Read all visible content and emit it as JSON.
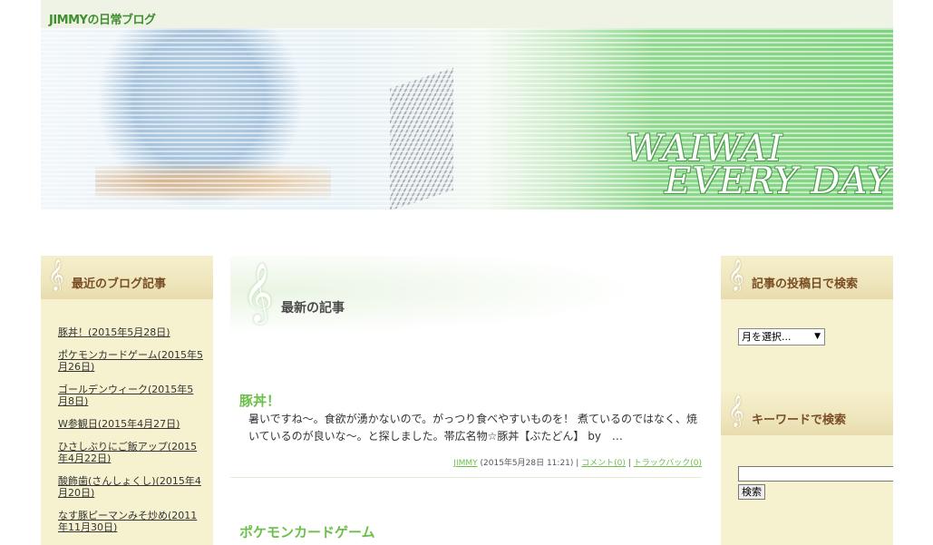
{
  "header": {
    "site_title": "JIMMYの日常ブログ",
    "banner_line1": "WAIWAI",
    "banner_line2": "EVERY DAY"
  },
  "left_sidebar": {
    "widget_title": "最近のブログ記事",
    "recent_posts": [
      "豚丼！(2015年5月28日)",
      "ポケモンカードゲーム(2015年5月26日)",
      "ゴールデンウィーク(2015年5月8日)",
      "W参観日(2015年4月27日)",
      "ひさしぶりにご飯アップ(2015年4月22日)",
      "酸飾歯(さんしょくし)(2015年4月20日)",
      "なす豚ピーマンみそ炒め(2011年11月30日)"
    ]
  },
  "main": {
    "section_title": "最新の記事",
    "post1": {
      "title": "豚丼！",
      "excerpt": "暑いですね～。食欲が湧かないので。がっつり食べやすいものを！ 煮ているのではなく、焼いているのが良いな～。と探しました。帯広名物☆豚丼【ぶたどん】 by　…",
      "author": "JIMMY",
      "date": " (2015年5月28日 11:21) | ",
      "comments": "コメント(0)",
      "separator": " | ",
      "trackbacks": "トラックバック(0)"
    },
    "post2": {
      "title": "ポケモンカードゲーム"
    }
  },
  "right_sidebar": {
    "archive_title": "記事の投稿日で検索",
    "month_select": "月を選択...",
    "keyword_title": "キーワードで検索",
    "search_button": "検索"
  },
  "colors": {
    "accent_green": "#6cbf4a",
    "sidebar_bg": "#f6f2d0",
    "widget_title": "#7a4d24"
  },
  "icons": [
    "treble-clef-icon",
    "dropdown-arrow-icon"
  ]
}
